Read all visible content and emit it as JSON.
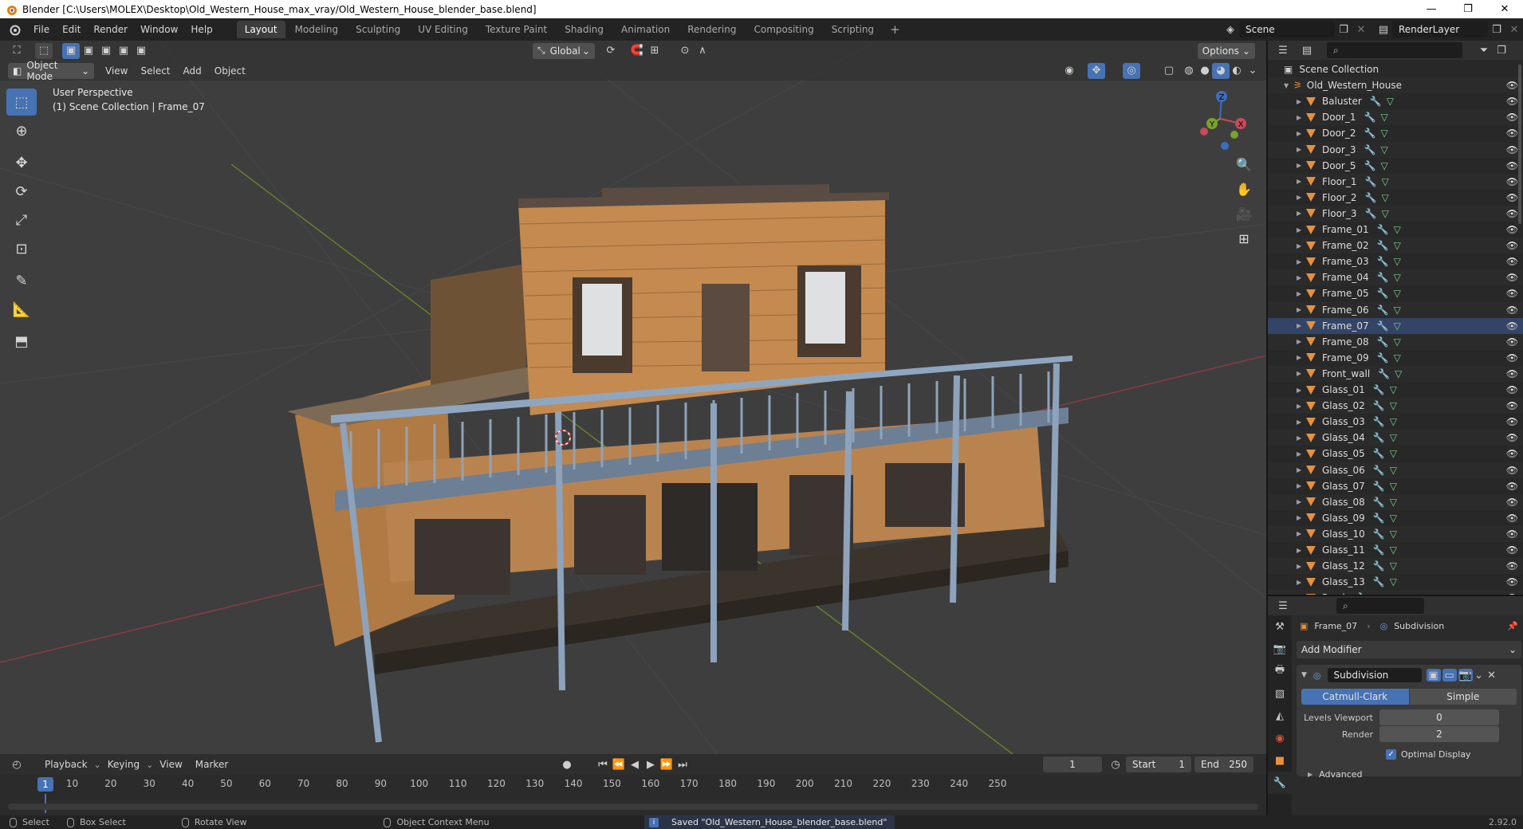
{
  "window": {
    "title": "Blender [C:\\Users\\MOLEX\\Desktop\\Old_Western_House_max_vray/Old_Western_House_blender_base.blend]",
    "min": "—",
    "max": "❐",
    "close": "✕"
  },
  "menu": [
    "File",
    "Edit",
    "Render",
    "Window",
    "Help"
  ],
  "workspaces": [
    "Layout",
    "Modeling",
    "Sculpting",
    "UV Editing",
    "Texture Paint",
    "Shading",
    "Animation",
    "Rendering",
    "Compositing",
    "Scripting"
  ],
  "workspace_add": "+",
  "scene": {
    "name": "Scene",
    "render_layer": "RenderLayer"
  },
  "viewport": {
    "mode": "Object Mode",
    "menus": [
      "View",
      "Select",
      "Add",
      "Object"
    ],
    "orientation": "Global",
    "options": "Options",
    "info_line1": "User Perspective",
    "info_line2": "(1) Scene Collection | Frame_07",
    "gizmo": {
      "z": "Z",
      "y": "Y",
      "x": "X"
    }
  },
  "timeline": {
    "menus": [
      "Playback",
      "Keying",
      "View",
      "Marker"
    ],
    "current_frame": "1",
    "start_label": "Start",
    "start": "1",
    "end_label": "End",
    "end": "250",
    "ticks": [
      "10",
      "20",
      "30",
      "40",
      "50",
      "60",
      "70",
      "80",
      "90",
      "100",
      "110",
      "120",
      "130",
      "140",
      "150",
      "160",
      "170",
      "180",
      "190",
      "200",
      "210",
      "220",
      "230",
      "240",
      "250"
    ]
  },
  "outliner": {
    "root": "Scene Collection",
    "collection": "Old_Western_House",
    "objects": [
      "Baluster",
      "Door_1",
      "Door_2",
      "Door_3",
      "Door_5",
      "Floor_1",
      "Floor_2",
      "Floor_3",
      "Frame_01",
      "Frame_02",
      "Frame_03",
      "Frame_04",
      "Frame_05",
      "Frame_06",
      "Frame_07",
      "Frame_08",
      "Frame_09",
      "Front_wall",
      "Glass_01",
      "Glass_02",
      "Glass_03",
      "Glass_04",
      "Glass_05",
      "Glass_06",
      "Glass_07",
      "Glass_08",
      "Glass_09",
      "Glass_10",
      "Glass_11",
      "Glass_12",
      "Glass_13",
      "Porch"
    ]
  },
  "properties": {
    "object": "Frame_07",
    "modifier_crumb": "Subdivision",
    "add_modifier": "Add Modifier",
    "modifier_name": "Subdivision",
    "algorithms": [
      "Catmull-Clark",
      "Simple"
    ],
    "levels_viewport_label": "Levels Viewport",
    "levels_viewport": "0",
    "render_label": "Render",
    "render_levels": "2",
    "optimal_display": "Optimal Display",
    "advanced": "Advanced"
  },
  "status": {
    "select": "Select",
    "box_select": "Box Select",
    "rotate_view": "Rotate View",
    "context_menu": "Object Context Menu",
    "saved": "Saved \"Old_Western_House_blender_base.blend\"",
    "version": "2.92.0"
  },
  "colors": {
    "accent": "#4772b3",
    "object_orange": "#e8903c",
    "mesh_green": "#79d28c"
  }
}
